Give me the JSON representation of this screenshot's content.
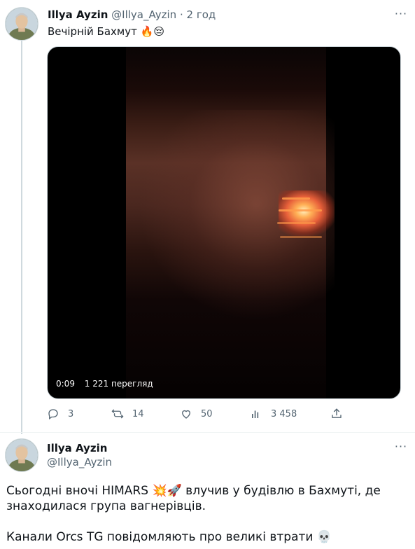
{
  "tweet1": {
    "author_name": "Illya Ayzin",
    "handle": "@Illya_Ayzin",
    "separator": "·",
    "time": "2 год",
    "text": "Вечірній Бахмут",
    "emojis": "🔥😔",
    "video": {
      "duration": "0:09",
      "views": "1 221 перегляд"
    },
    "actions": {
      "replies": "3",
      "retweets": "14",
      "likes": "50",
      "views": "3 458"
    }
  },
  "tweet2": {
    "author_name": "Illya Ayzin",
    "handle": "@Illya_Ayzin",
    "line1_prefix": "Сьогодні вночі HIMARS ",
    "line1_emojis": "💥🚀",
    "line1_suffix": " влучив у будівлю в Бахмуті, де",
    "line2": "знаходилася група вагнерівців.",
    "line3": "Канали Orcs TG повідомляють про великі втрати ",
    "line3_emoji": "💀"
  },
  "icons": {
    "more": "more-icon",
    "reply": "reply-icon",
    "retweet": "retweet-icon",
    "like": "heart-icon",
    "views": "views-icon",
    "share": "share-icon"
  },
  "colors": {
    "text": "#0f1419",
    "secondary": "#536471",
    "border": "#cfd9de"
  }
}
